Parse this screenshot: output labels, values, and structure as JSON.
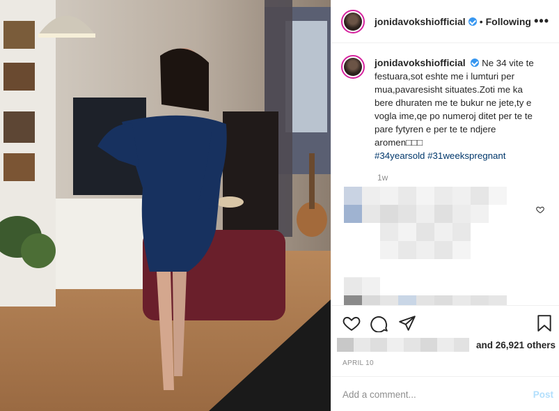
{
  "post": {
    "username": "jonidavokshiofficial",
    "follow_status": "Following",
    "more_label": "•••",
    "separator": "•"
  },
  "caption": {
    "username": "jonidavokshiofficial",
    "text": "Ne 34 vite te festuara,sot eshte me i lumturi per mua,pavaresisht situates.Zoti me ka bere dhuraten me te bukur ne jete,ty e vogla ime,qe po numeroj ditet per te te pare fytyren e per te te ndjere aromen□□□",
    "hashtags": "#34yearsold #31weekspregnant",
    "time_ago": "1w"
  },
  "likes": {
    "others_text": "and 26,921 others"
  },
  "date": "APRIL 10",
  "comment_box": {
    "placeholder": "Add a comment...",
    "post_label": "Post"
  },
  "colors": {
    "verified_blue": "#3897f0",
    "hashtag": "#00376b",
    "post_disabled": "#b2dffc"
  },
  "icons": [
    "verified-badge-icon",
    "heart-icon",
    "comment-icon",
    "share-icon",
    "bookmark-icon",
    "more-icon"
  ]
}
